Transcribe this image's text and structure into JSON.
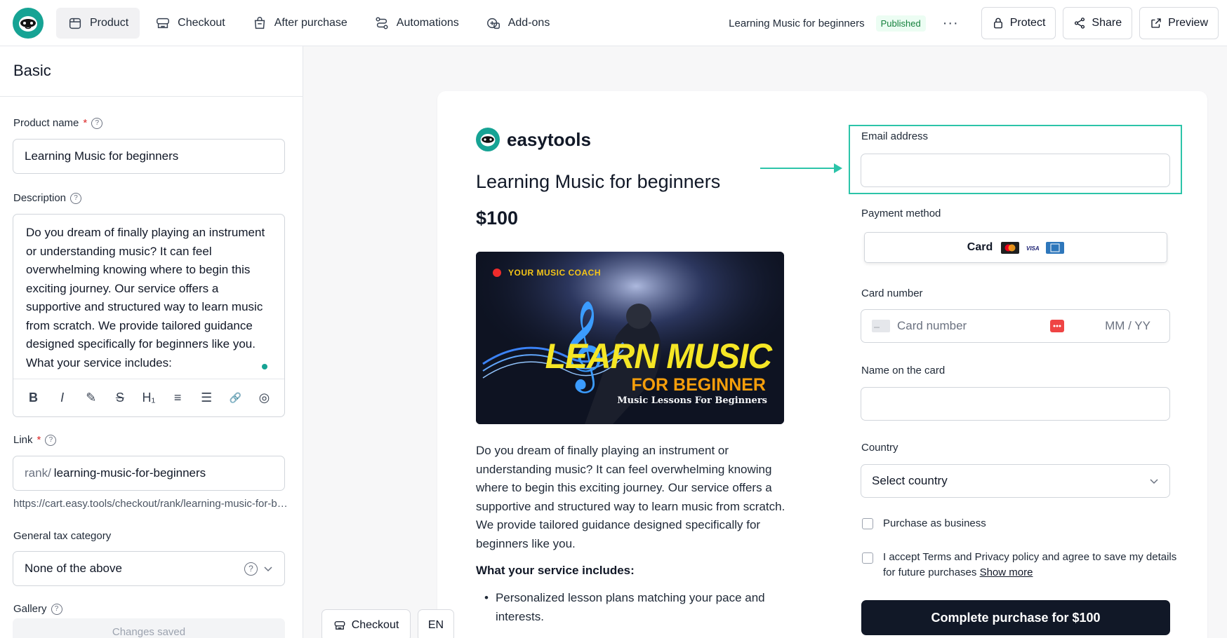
{
  "nav": {
    "items": [
      {
        "label": "Product",
        "icon": "box-icon",
        "active": true
      },
      {
        "label": "Checkout",
        "icon": "checkout-icon"
      },
      {
        "label": "After purchase",
        "icon": "bag-icon"
      },
      {
        "label": "Automations",
        "icon": "automation-icon"
      },
      {
        "label": "Add-ons",
        "icon": "addons-icon"
      }
    ]
  },
  "header": {
    "product_title": "Learning Music for beginners",
    "status": "Published",
    "more": "···",
    "protect": "Protect",
    "share": "Share",
    "preview": "Preview"
  },
  "left": {
    "section_title": "Basic",
    "product_name_label": "Product name",
    "required_mark": "*",
    "product_name_value": "Learning Music for beginners",
    "description_label": "Description",
    "description_value": "Do you dream of finally playing an instrument or understanding music? It can feel overwhelming knowing where to begin this exciting journey. Our service offers a supportive and structured way to learn music from scratch. We provide tailored guidance designed specifically for beginners like you. What your service includes:",
    "toolbar": [
      "B",
      "I",
      "✎",
      "S",
      "H₁",
      "≡",
      "☰",
      "🔗",
      "◎"
    ],
    "link_label": "Link",
    "link_prefix": "rank/",
    "link_value": "learning-music-for-beginners",
    "link_full": "https://cart.easy.tools/checkout/rank/learning-music-for-beginners",
    "tax_label": "General tax category",
    "tax_value": "None of the above",
    "gallery_label": "Gallery",
    "changes_saved": "Changes saved"
  },
  "preview": {
    "brand": "easytools",
    "title": "Learning Music for beginners",
    "price": "$100",
    "hero": {
      "tag": "YOUR MUSIC COACH",
      "line1": "LEARN MUSIC",
      "line2": "FOR BEGINNER",
      "line3": "Music Lessons For Beginners"
    },
    "description": "Do you dream of finally playing an instrument or understanding music? It can feel overwhelming knowing where to begin this exciting journey. Our service offers a supportive and structured way to learn music from scratch. We provide tailored guidance designed specifically for beginners like you.",
    "includes_title": "What your service includes:",
    "bullets": [
      "Personalized lesson plans matching your pace and interests."
    ]
  },
  "form": {
    "email_label": "Email address",
    "payment_label": "Payment method",
    "payment_option": "Card",
    "card_number_label": "Card number",
    "card_number_placeholder": "Card number",
    "expiry_placeholder": "MM / YY",
    "name_label": "Name on the card",
    "country_label": "Country",
    "country_placeholder": "Select country",
    "business_label": "Purchase as business",
    "terms_text": "I accept Terms and Privacy policy and agree to save my details for future purchases",
    "show_more": "Show more",
    "cta": "Complete purchase for $100"
  },
  "bottom": {
    "checkout": "Checkout",
    "lang": "EN"
  },
  "colors": {
    "accent": "#16a394",
    "highlight": "#2cc4a9",
    "cta": "#111827"
  }
}
